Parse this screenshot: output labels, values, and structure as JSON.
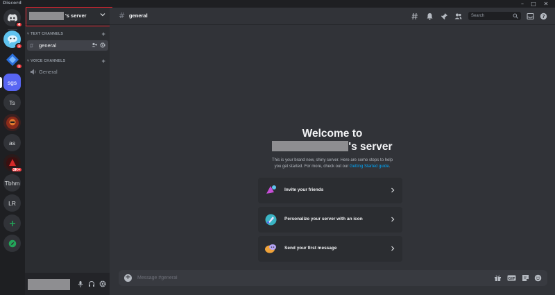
{
  "titlebar": {
    "app_name": "Discord",
    "minimize": "–",
    "maximize": "□",
    "close": "✕"
  },
  "servers": [
    {
      "kind": "home",
      "badge": "4"
    },
    {
      "kind": "bubble",
      "badge": "1"
    },
    {
      "kind": "diamond",
      "badge": "1"
    },
    {
      "kind": "text",
      "label": "sgs",
      "active": true
    },
    {
      "kind": "text",
      "label": "Ts"
    },
    {
      "kind": "avatar"
    },
    {
      "kind": "text",
      "label": "as"
    },
    {
      "kind": "avatar2",
      "badge": "3K+"
    },
    {
      "kind": "text",
      "label": "Tbhm"
    },
    {
      "kind": "text",
      "label": "LR"
    }
  ],
  "server_header": {
    "name_suffix": "'s server"
  },
  "categories": {
    "text": "TEXT CHANNELS",
    "voice": "VOICE CHANNELS"
  },
  "channels": {
    "text_general": "general",
    "voice_general": "General"
  },
  "topbar": {
    "channel_name": "general",
    "search_placeholder": "Search"
  },
  "welcome": {
    "title_line1": "Welcome to",
    "title_suffix": "'s server",
    "sub_line1": "This is your brand new, shiny server. Here are some steps to help",
    "sub_line2_prefix": "you get started. For more, check out our ",
    "sub_link": "Getting Started guide",
    "sub_line2_suffix": "."
  },
  "tasks": [
    {
      "label": "Invite your friends",
      "icon": "invite-friends-icon",
      "color": "#c64ed6"
    },
    {
      "label": "Personalize your server with an icon",
      "icon": "personalize-icon",
      "color": "#3ab4c4"
    },
    {
      "label": "Send your first message",
      "icon": "send-message-icon",
      "color": "#f0a33a"
    }
  ],
  "composer": {
    "placeholder": "Message #general"
  },
  "colors": {
    "accent": "#5865f2",
    "highlight": "#e0232e",
    "link": "#00a8fc",
    "badge": "#f23f43"
  }
}
